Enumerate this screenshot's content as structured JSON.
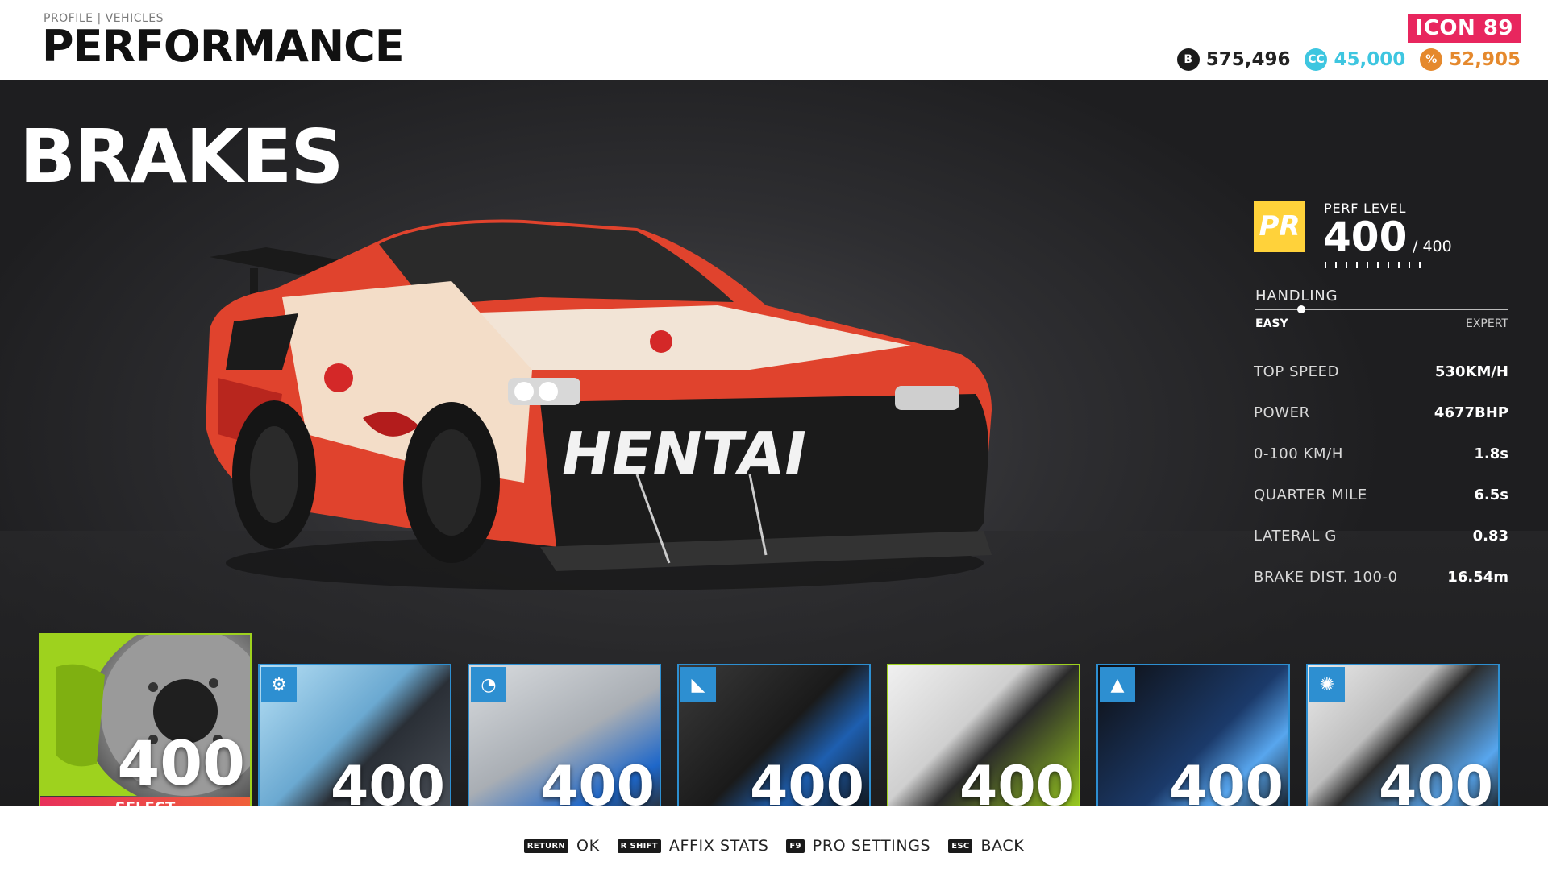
{
  "header": {
    "breadcrumb": "PROFILE | VEHICLES",
    "title": "PERFORMANCE",
    "rank": "ICON 89",
    "currencies": [
      {
        "icon": "bucks-icon",
        "value": "575,496"
      },
      {
        "icon": "crew-credits-icon",
        "value": "45,000"
      },
      {
        "icon": "coin-icon",
        "value": "52,905"
      }
    ]
  },
  "section": {
    "title": "BRAKES"
  },
  "car": {
    "livery_text": "HENTAI"
  },
  "stats": {
    "perf_label": "PERF LEVEL",
    "perf_value": "400",
    "perf_max": "/ 400",
    "logo_text": "PR",
    "handling_label": "HANDLING",
    "handling_easy": "EASY",
    "handling_expert": "EXPERT",
    "handling_position": 0.18,
    "rows": [
      {
        "name": "TOP SPEED",
        "value": "530KM/H"
      },
      {
        "name": "POWER",
        "value": "4677BHP"
      },
      {
        "name": "0-100 KM/H",
        "value": "1.8s"
      },
      {
        "name": "QUARTER MILE",
        "value": "6.5s"
      },
      {
        "name": "LATERAL G",
        "value": "0.83"
      },
      {
        "name": "BRAKE DIST. 100-0",
        "value": "16.54m"
      }
    ]
  },
  "parts": [
    {
      "name": "brakes",
      "value": "400",
      "selected": true,
      "select_label": "SELECT"
    },
    {
      "name": "transmission",
      "value": "400",
      "icon": "gear-icon"
    },
    {
      "name": "ecu",
      "value": "400",
      "icon": "gauge-icon"
    },
    {
      "name": "air-filter",
      "value": "400",
      "icon": "turbo-icon"
    },
    {
      "name": "exhaust",
      "value": "400"
    },
    {
      "name": "suspension",
      "value": "400",
      "icon": "spring-icon"
    },
    {
      "name": "tires",
      "value": "400",
      "icon": "tire-icon"
    }
  ],
  "footer": {
    "hints": [
      {
        "key": "RETURN",
        "label": "OK"
      },
      {
        "key": "R SHIFT",
        "label": "AFFIX STATS"
      },
      {
        "key": "F9",
        "label": "PRO SETTINGS"
      },
      {
        "key": "ESC",
        "label": "BACK"
      }
    ]
  },
  "colors": {
    "accent_pink": "#e8265e",
    "crew_credits": "#3ec6e0",
    "coins": "#e5892d",
    "perf_yellow": "#ffd23a",
    "select_green": "#9ed21e",
    "part_blue": "#2d8fd1"
  }
}
